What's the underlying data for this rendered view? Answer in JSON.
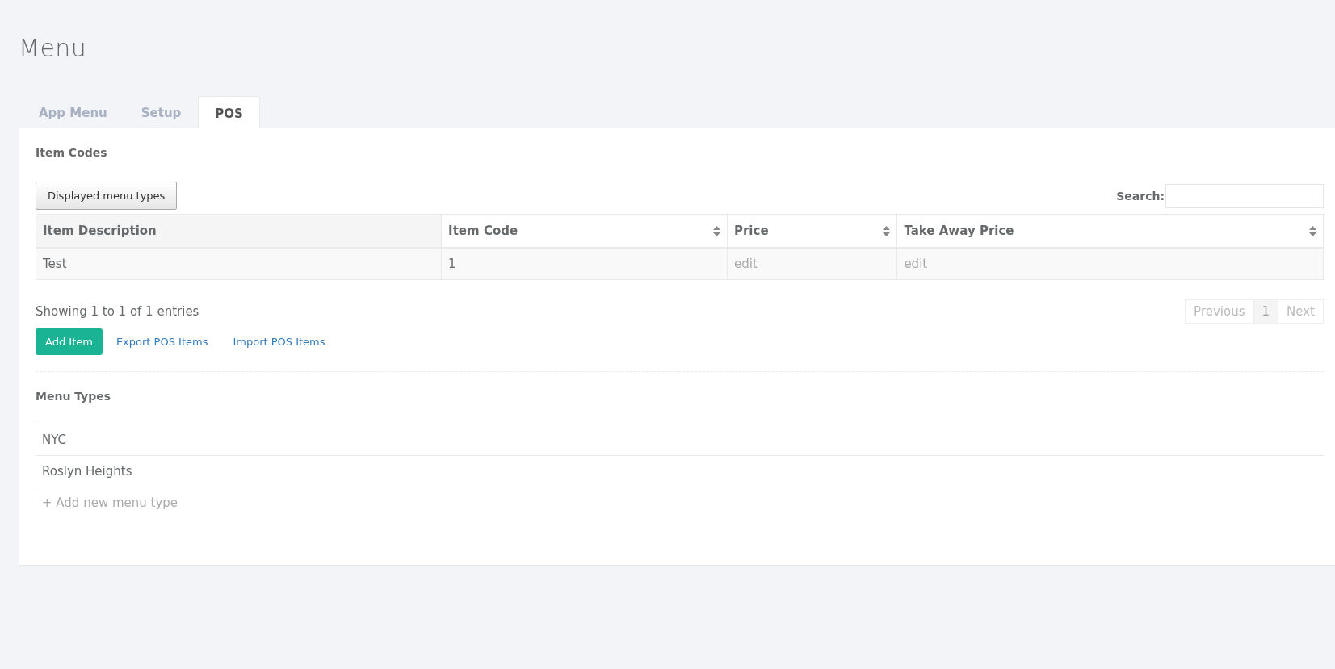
{
  "page": {
    "title": "Menu"
  },
  "tabs": [
    {
      "label": "App Menu",
      "selected": false
    },
    {
      "label": "Setup",
      "selected": false
    },
    {
      "label": "POS",
      "selected": true
    }
  ],
  "item_codes": {
    "heading": "Item Codes",
    "filter_button": "Displayed menu types",
    "search_label": "Search:",
    "columns": [
      {
        "label": "Item Description",
        "sortable": false
      },
      {
        "label": "Item Code",
        "sortable": true
      },
      {
        "label": "Price",
        "sortable": true
      },
      {
        "label": "Take Away Price",
        "sortable": true
      }
    ],
    "rows": [
      {
        "cells": [
          {
            "text": "Test",
            "kind": "value"
          },
          {
            "text": "1",
            "kind": "value"
          },
          {
            "text": "edit",
            "kind": "placeholder"
          },
          {
            "text": "edit",
            "kind": "placeholder"
          }
        ]
      }
    ],
    "info": "Showing 1 to 1 of 1 entries",
    "pagination": [
      {
        "label": "Previous",
        "selected": false,
        "disabled": true
      },
      {
        "label": "1",
        "selected": true,
        "disabled": false
      },
      {
        "label": "Next",
        "selected": false,
        "disabled": true
      }
    ],
    "actions": [
      {
        "label": "Add Item",
        "kind": "button"
      },
      {
        "label": "Export POS Items",
        "kind": "link"
      },
      {
        "label": "Import POS Items",
        "kind": "link"
      }
    ]
  },
  "menu_types": {
    "heading": "Menu Types",
    "items": [
      "NYC",
      "Roslyn Heights"
    ],
    "add_new": "+ Add new menu type"
  }
}
